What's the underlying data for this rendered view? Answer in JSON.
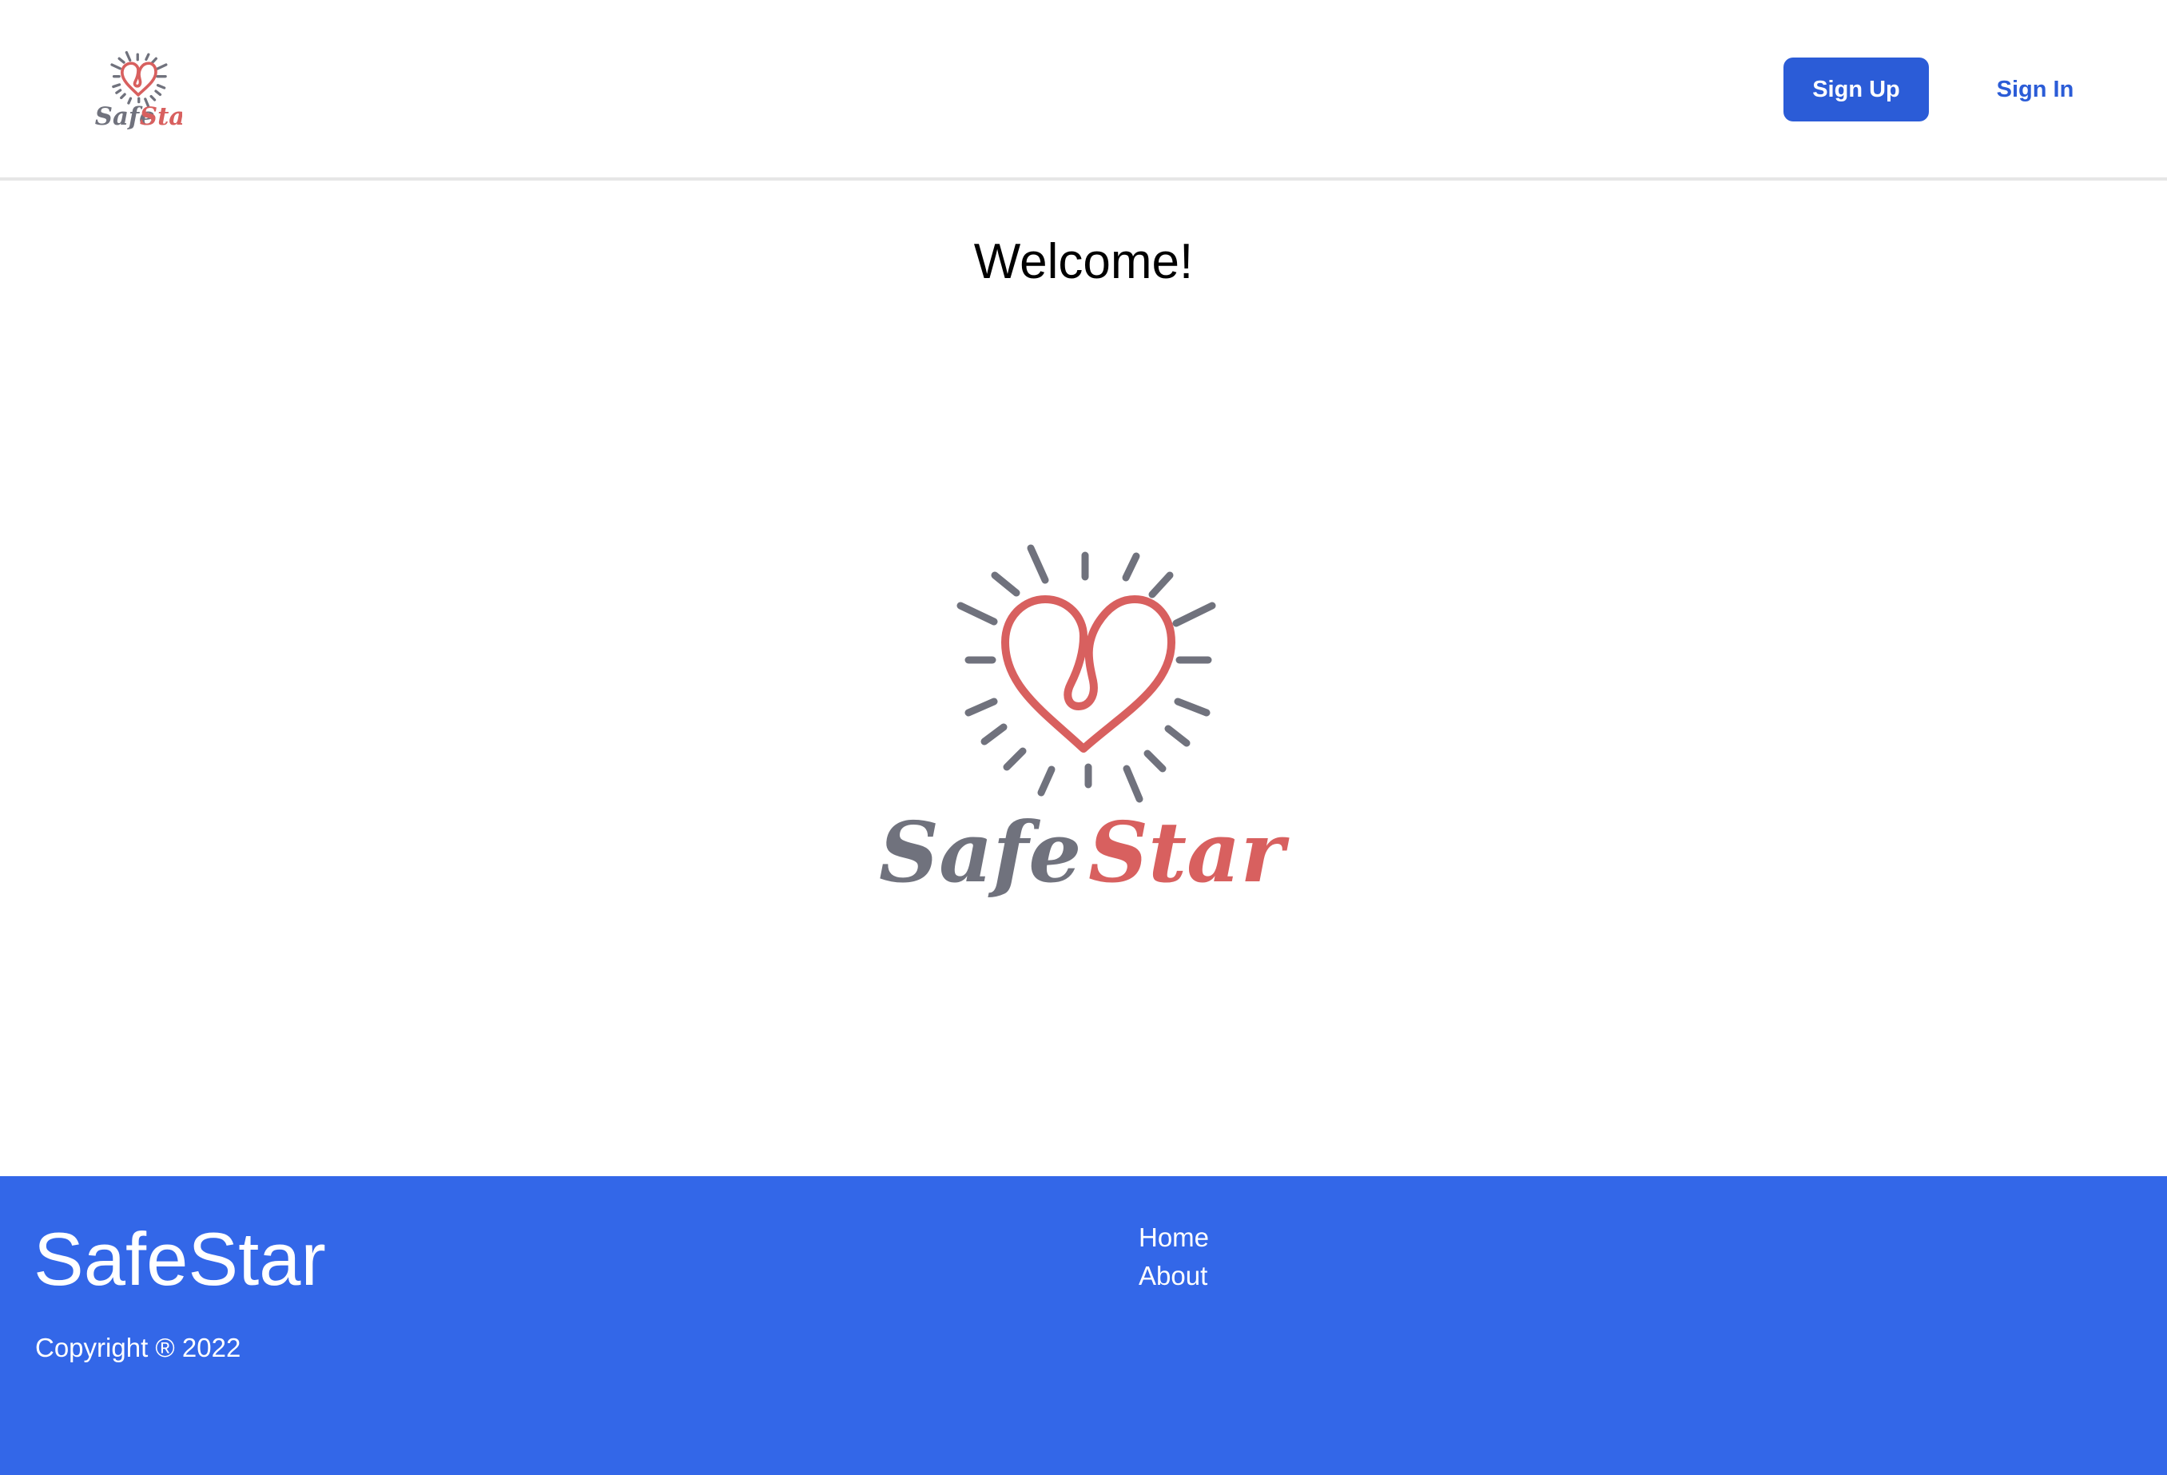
{
  "header": {
    "logo": {
      "word_part1": "Safe",
      "word_part2": "Star",
      "icon": "heart-sun-logo-icon"
    },
    "signup_label": "Sign Up",
    "signin_label": "Sign In"
  },
  "main": {
    "heading": "Welcome!",
    "hero_logo": {
      "word_part1": "Safe",
      "word_part2": "Star",
      "icon": "heart-sun-logo-icon"
    }
  },
  "footer": {
    "brand": "SafeStar",
    "copyright": "Copyright ® 2022",
    "links": [
      {
        "label": "Home"
      },
      {
        "label": "About"
      }
    ]
  },
  "colors": {
    "primary": "#2b5cd7",
    "footer_bg": "#3367e8",
    "logo_red": "#d8605f",
    "logo_gray": "#70727d"
  }
}
